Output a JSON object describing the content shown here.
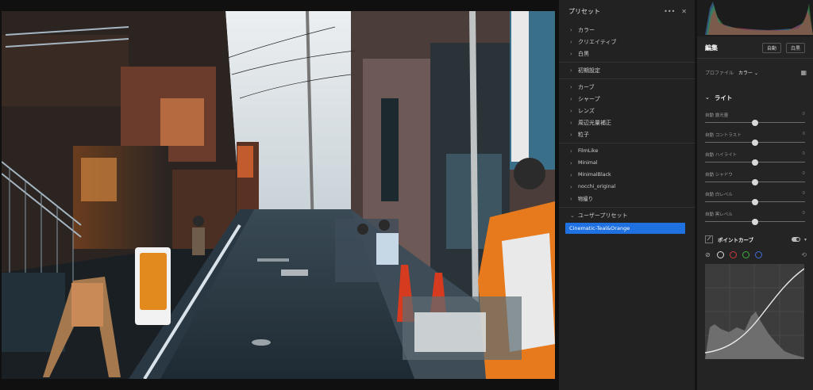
{
  "presets_panel": {
    "title": "プリセット",
    "more_icon": "ellipsis-icon",
    "close_icon": "close-icon",
    "groups": [
      {
        "items": [
          "カラー",
          "クリエイティブ",
          "白黒"
        ]
      },
      {
        "items": [
          "初期設定"
        ]
      },
      {
        "items": [
          "カーブ",
          "シャープ",
          "レンズ",
          "周辺光量補正",
          "粒子"
        ]
      },
      {
        "items": [
          "FilmLike",
          "Minimal",
          "MinimalBlack",
          "nocchi_original",
          "物撮り"
        ]
      }
    ],
    "user_group": {
      "label": "ユーザープリセット",
      "selected": "Cinematic-Teal&Orange"
    },
    "selected_color": "#1f70e0"
  },
  "edit_panel": {
    "title": "編集",
    "auto_button": "自動",
    "bw_button": "白黒",
    "profile_label": "プロファイル",
    "profile_value": "カラー",
    "light_section": "ライト",
    "sliders": [
      {
        "label": "自動 露光量",
        "value": "0",
        "level": 0.5
      },
      {
        "label": "自動 コントラスト",
        "value": "0",
        "level": 0.5
      },
      {
        "label": "自動 ハイライト",
        "value": "0",
        "level": 0.5
      },
      {
        "label": "自動 シャドウ",
        "value": "0",
        "level": 0.5
      },
      {
        "label": "自動 白レベル",
        "value": "0",
        "level": 0.5
      },
      {
        "label": "自動 黒レベル",
        "value": "0",
        "level": 0.5
      }
    ],
    "point_curve": "ポイントカーブ",
    "channel_colors": [
      "#dddddd",
      "#d23a3a",
      "#3fae3f",
      "#3f6fd8"
    ]
  }
}
